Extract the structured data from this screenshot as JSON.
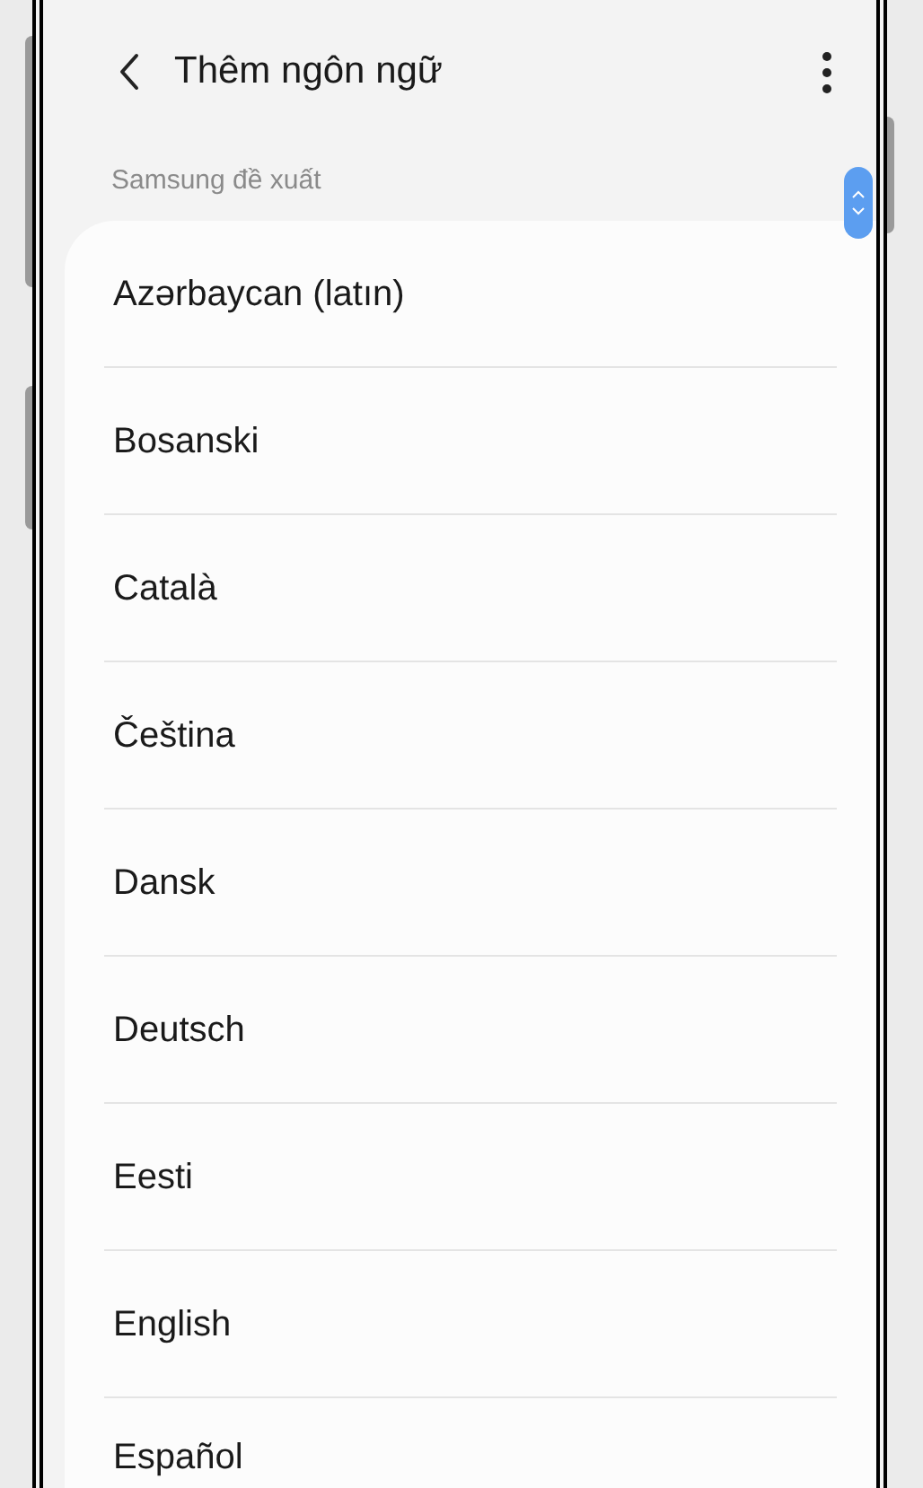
{
  "header": {
    "title": "Thêm ngôn ngữ"
  },
  "section": {
    "label": "Samsung đề xuất"
  },
  "languages": [
    {
      "name": "Azərbaycan (latın)"
    },
    {
      "name": "Bosanski"
    },
    {
      "name": "Català"
    },
    {
      "name": "Čeština"
    },
    {
      "name": "Dansk"
    },
    {
      "name": "Deutsch"
    },
    {
      "name": "Eesti"
    },
    {
      "name": "English"
    },
    {
      "name": "Español"
    }
  ]
}
